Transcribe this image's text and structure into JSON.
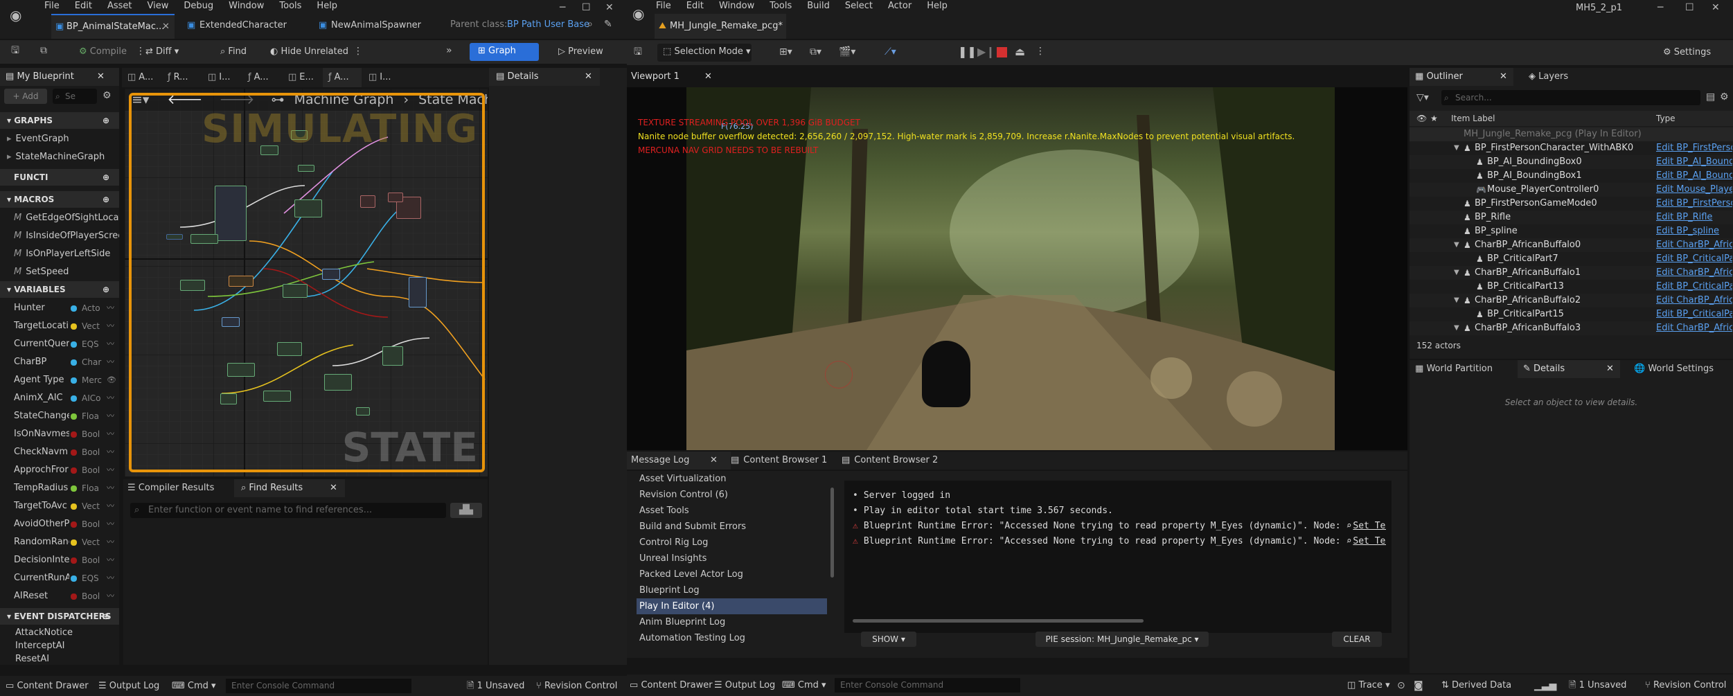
{
  "left_window": {
    "menu": [
      "File",
      "Edit",
      "Asset",
      "View",
      "Debug",
      "Window",
      "Tools",
      "Help"
    ],
    "tabs": [
      {
        "label": "BP_AnimalStateMac..."
      },
      {
        "label": "ExtendedCharacter"
      },
      {
        "label": "NewAnimalSpawner"
      }
    ],
    "parent_class_label": "Parent class:",
    "parent_class_value": "BP Path User Base",
    "toolbar": {
      "compile": "Compile",
      "diff": "Diff",
      "find": "Find",
      "hide_unrelated": "Hide Unrelated",
      "graph": "Graph",
      "preview": "Preview"
    },
    "my_blueprint": {
      "title": "My Blueprint",
      "add": "+ Add",
      "search_placeholder": "Se",
      "sections": {
        "graphs": "GRAPHS",
        "functions": "FUNCTI",
        "macros": "MACROS",
        "variables": "VARIABLES",
        "event_dispatchers": "EVENT DISPATCHERS"
      },
      "graphs": [
        "EventGraph",
        "StateMachineGraph"
      ],
      "macros": [
        "GetEdgeOfSightLocatio",
        "IsInsideOfPlayerScree",
        "IsOnPlayerLeftSide",
        "SetSpeed"
      ],
      "variables": [
        {
          "name": "Hunter",
          "type": "Acto",
          "color": "#39b0e6"
        },
        {
          "name": "TargetLocati",
          "type": "Vect",
          "color": "#e6c21f"
        },
        {
          "name": "CurrentQuer",
          "type": "EQS",
          "color": "#39b0e6"
        },
        {
          "name": "CharBP",
          "type": "Char",
          "color": "#39b0e6"
        },
        {
          "name": "Agent Type",
          "type": "Merc",
          "color": "#39b0e6",
          "eye": true
        },
        {
          "name": "AnimX_AIC",
          "type": "AICo",
          "color": "#39b0e6"
        },
        {
          "name": "StateChange",
          "type": "Floa",
          "color": "#7ec63c"
        },
        {
          "name": "IsOnNavmes",
          "type": "Bool",
          "color": "#a31818"
        },
        {
          "name": "CheckNavm",
          "type": "Bool",
          "color": "#a31818"
        },
        {
          "name": "ApprochFror",
          "type": "Bool",
          "color": "#a31818"
        },
        {
          "name": "TempRadius",
          "type": "Floa",
          "color": "#7ec63c"
        },
        {
          "name": "TargetToAvc",
          "type": "Vect",
          "color": "#e6c21f"
        },
        {
          "name": "AvoidOtherP",
          "type": "Bool",
          "color": "#a31818"
        },
        {
          "name": "RandomRanc",
          "type": "Vect",
          "color": "#e6c21f"
        },
        {
          "name": "DecisionInte",
          "type": "Bool",
          "color": "#a31818"
        },
        {
          "name": "CurrentRunA",
          "type": "EQS",
          "color": "#39b0e6"
        },
        {
          "name": "AIReset",
          "type": "Bool",
          "color": "#a31818"
        }
      ],
      "dispatchers": [
        "AttackNotice",
        "InterceptAI",
        "ResetAI"
      ]
    },
    "graph_tabs": [
      "A...",
      "R...",
      "I...",
      "A...",
      "E...",
      "A...",
      "I..."
    ],
    "details_tab": "Details",
    "graph": {
      "breadcrumb_1": "Machine Graph",
      "breadcrumb_2": "State Machine",
      "watermark_top": "SIMULATING",
      "watermark_bottom": "STATE"
    },
    "bottom_tabs": {
      "compiler": "Compiler Results",
      "find": "Find Results",
      "find_placeholder": "Enter function or event name to find references..."
    },
    "status": {
      "content_drawer": "Content Drawer",
      "output_log": "Output Log",
      "cmd": "Cmd",
      "console_placeholder": "Enter Console Command",
      "unsaved": "1 Unsaved",
      "revision": "Revision Control"
    }
  },
  "right_window": {
    "menu": [
      "File",
      "Edit",
      "Window",
      "Tools",
      "Build",
      "Select",
      "Actor",
      "Help"
    ],
    "project": "MH5_2_p1",
    "level_tab": "MH_Jungle_Remake_pcg*",
    "selection_mode": "Selection Mode",
    "settings": "Settings",
    "viewport_tab": "Viewport 1",
    "overlay": {
      "fps": "F(76.25)",
      "line1": "TEXTURE STREAMING POOL OVER 1,396 GiB BUDGET",
      "line2": "Nanite node buffer overflow detected: 2,656,260 / 2,097,152. High-water mark is 2,859,709. Increase r.Nanite.MaxNodes to prevent potential visual artifacts.",
      "line3": "MERCUNA NAV GRID NEEDS TO BE REBUILT"
    },
    "outliner": {
      "tab": "Outliner",
      "layers_tab": "Layers",
      "search_placeholder": "Search...",
      "col_label": "Item Label",
      "col_type": "Type",
      "root": "MH_Jungle_Remake_pcg (Play In Editor)",
      "rows": [
        {
          "label": "BP_FirstPersonCharacter_WithABK0",
          "type": "Edit BP_FirstPerso",
          "indent": 1,
          "arrow": true
        },
        {
          "label": "BP_AI_BoundingBox0",
          "type": "Edit BP_AI_Boundin",
          "indent": 2
        },
        {
          "label": "BP_AI_BoundingBox1",
          "type": "Edit BP_AI_Boundin",
          "indent": 2
        },
        {
          "label": "Mouse_PlayerController0",
          "type": "Edit Mouse_Player",
          "indent": 2
        },
        {
          "label": "BP_FirstPersonGameMode0",
          "type": "Edit BP_FirstPerso",
          "indent": 1
        },
        {
          "label": "BP_Rifle",
          "type": "Edit BP_Rifle",
          "indent": 1
        },
        {
          "label": "BP_spline",
          "type": "Edit BP_spline",
          "indent": 1
        },
        {
          "label": "CharBP_AfricanBuffalo0",
          "type": "Edit CharBP_Africa",
          "indent": 1,
          "arrow": true
        },
        {
          "label": "BP_CriticalPart7",
          "type": "Edit BP_CriticalPar",
          "indent": 2
        },
        {
          "label": "CharBP_AfricanBuffalo1",
          "type": "Edit CharBP_Africa",
          "indent": 1,
          "arrow": true
        },
        {
          "label": "BP_CriticalPart13",
          "type": "Edit BP_CriticalPar",
          "indent": 2
        },
        {
          "label": "CharBP_AfricanBuffalo2",
          "type": "Edit CharBP_Africa",
          "indent": 1,
          "arrow": true
        },
        {
          "label": "BP_CriticalPart15",
          "type": "Edit BP_CriticalPar",
          "indent": 2
        },
        {
          "label": "CharBP_AfricanBuffalo3",
          "type": "Edit CharBP_Africa",
          "indent": 1,
          "arrow": true
        }
      ],
      "count": "152 actors"
    },
    "lower_tabs": {
      "world_partition": "World Partition",
      "details": "Details",
      "world_settings": "World Settings",
      "empty_msg": "Select an object to view details."
    },
    "message_log": {
      "tabs": [
        "Message Log",
        "Content Browser 1",
        "Content Browser 2"
      ],
      "categories": [
        "Asset Virtualization",
        "Revision Control (6)",
        "Asset Tools",
        "Build and Submit Errors",
        "Control Rig Log",
        "Unreal Insights",
        "Packed Level Actor Log",
        "Blueprint Log",
        "Play In Editor (4)",
        "Anim Blueprint Log",
        "Automation Testing Log"
      ],
      "selected_index": 8,
      "messages": [
        {
          "text": "Server logged in",
          "error": false
        },
        {
          "text": "Play in editor total start time 3.567 seconds.",
          "error": false
        },
        {
          "text": "Blueprint Runtime Error: \"Accessed None trying to read property M_Eyes (dynamic)\". Node:",
          "link": "Set Texture Pa",
          "error": true
        },
        {
          "text": "Blueprint Runtime Error: \"Accessed None trying to read property M_Eyes (dynamic)\". Node:",
          "link": "Set Texture Pa",
          "error": true
        }
      ],
      "show": "SHOW",
      "pie_session": "PIE session: MH_Jungle_Remake_pc",
      "clear": "CLEAR"
    },
    "status": {
      "content_drawer": "Content Drawer",
      "output_log": "Output Log",
      "cmd": "Cmd",
      "console_placeholder": "Enter Console Command",
      "trace": "Trace",
      "derived": "Derived Data",
      "unsaved": "1 Unsaved",
      "revision": "Revision Control"
    }
  }
}
